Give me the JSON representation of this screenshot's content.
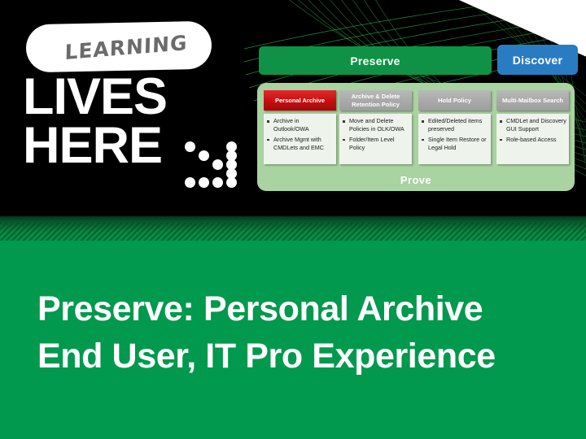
{
  "brand": {
    "pill_text": "LEARNING",
    "line1": "LIVES",
    "line2": "HERE",
    "dots_icon": "chevron-dots-icon"
  },
  "header": {
    "preserve_label": "Preserve",
    "discover_label": "Discover",
    "preserve_color": "#0f9245",
    "discover_color": "#2a7cc2"
  },
  "diagram": {
    "panel_label": "Prove",
    "panel_color": "#a9d3a0",
    "columns": [
      {
        "head": "Personal Archive",
        "highlight": true,
        "head_color": "#c40f10",
        "bullets": [
          "Archive in Outlook/OWA",
          "Archive Mgmt with CMDLets and EMC"
        ]
      },
      {
        "head": "Archive & Delete Retention Policy",
        "highlight": false,
        "head_color": "#a9a9a9",
        "bullets": [
          "Move and Delete Policies in OLK/OWA",
          "Folder/Item Level Policy"
        ]
      },
      {
        "head": "Hold Policy",
        "highlight": false,
        "head_color": "#a9a9a9",
        "bullets": [
          "Edited/Deleted items preserved",
          "Single Item Restore or Legal Hold"
        ]
      },
      {
        "head": "Multi-Mailbox Search",
        "highlight": false,
        "head_color": "#a9a9a9",
        "bullets": [
          "CMDLet and Discovery GUI Support",
          "Role-based Access"
        ]
      }
    ]
  },
  "slide": {
    "title_line1": "Preserve: Personal Archive",
    "title_line2": "End User, IT Pro Experience",
    "background_color": "#00994d"
  }
}
